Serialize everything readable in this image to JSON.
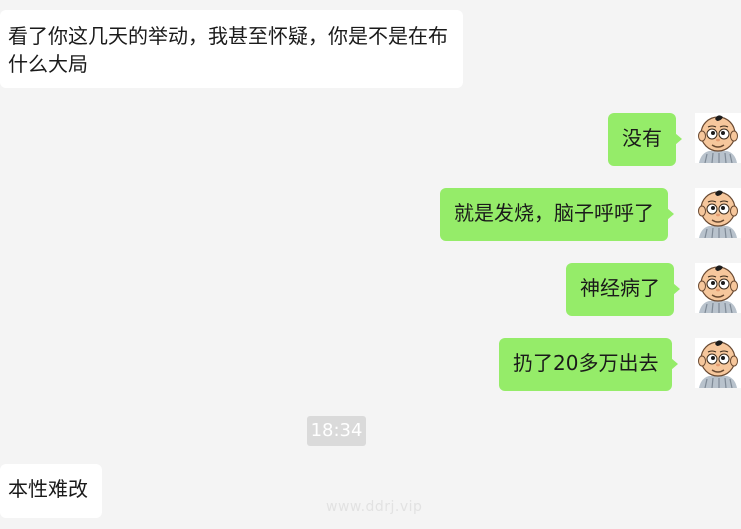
{
  "chat": {
    "messages": [
      {
        "side": "incoming",
        "text": "看了你这几天的举动，我甚至怀疑，你是不是在布什么大局"
      },
      {
        "side": "outgoing",
        "text": "没有"
      },
      {
        "side": "outgoing",
        "text": "就是发烧，脑子呼呼了"
      },
      {
        "side": "outgoing",
        "text": "神经病了"
      },
      {
        "side": "outgoing",
        "text": "扔了20多万出去"
      },
      {
        "side": "incoming",
        "text": "本性难改"
      }
    ],
    "timestamp": "18:34",
    "watermark": "www.ddrj.vip"
  },
  "avatar": {
    "icon": "cartoon-baby-avatar-icon"
  },
  "colors": {
    "background": "#f4f4f4",
    "incoming_bubble": "#ffffff",
    "outgoing_bubble": "#95ec69",
    "timestamp_chip": "#dadada"
  }
}
